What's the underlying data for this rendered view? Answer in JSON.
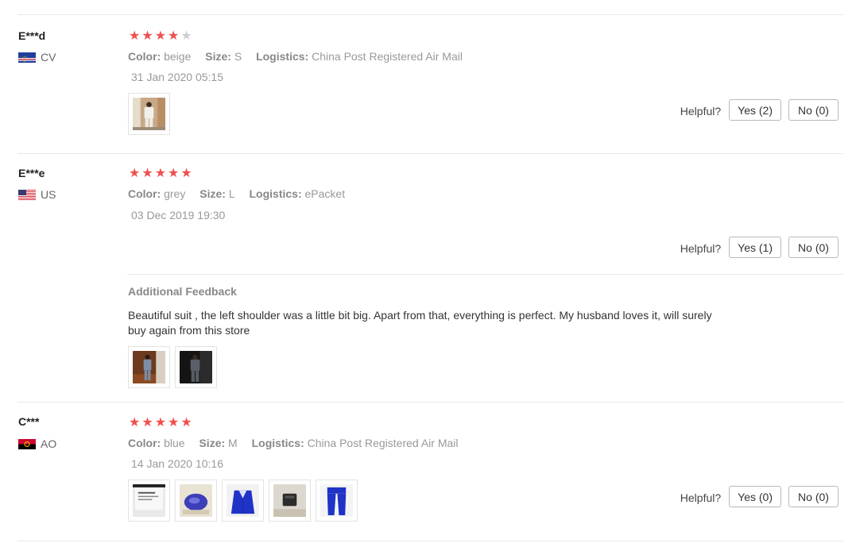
{
  "reviews": [
    {
      "user": "E***d",
      "country_code": "CV",
      "flag_icon": "cape-verde-flag-icon",
      "rating": 4,
      "color_label": "Color:",
      "color": "beige",
      "size_label": "Size:",
      "size": "S",
      "logistics_label": "Logistics:",
      "logistics": "China Post Registered Air Mail",
      "date": "31 Jan 2020 05:15",
      "helpful_label": "Helpful?",
      "yes_label": "Yes (2)",
      "no_label": "No (0)"
    },
    {
      "user": "E***e",
      "country_code": "US",
      "flag_icon": "usa-flag-icon",
      "rating": 5,
      "color_label": "Color:",
      "color": "grey",
      "size_label": "Size:",
      "size": "L",
      "logistics_label": "Logistics:",
      "logistics": "ePacket",
      "date": "03 Dec 2019 19:30",
      "helpful_label": "Helpful?",
      "yes_label": "Yes (1)",
      "no_label": "No (0)",
      "additional_feedback_title": "Additional Feedback",
      "additional_feedback_text": "Beautiful suit , the left shoulder was a little bit big. Apart from that, everything is perfect. My husband loves it, will surely buy again from this store"
    },
    {
      "user": "C***",
      "country_code": "AO",
      "flag_icon": "angola-flag-icon",
      "rating": 5,
      "color_label": "Color:",
      "color": "blue",
      "size_label": "Size:",
      "size": "M",
      "logistics_label": "Logistics:",
      "logistics": "China Post Registered Air Mail",
      "date": "14 Jan 2020 10:16",
      "helpful_label": "Helpful?",
      "yes_label": "Yes (0)",
      "no_label": "No (0)"
    }
  ],
  "colors": {
    "star_on": "#f05050",
    "star_off": "#cfcfcf",
    "divider": "#e8e8e8"
  }
}
